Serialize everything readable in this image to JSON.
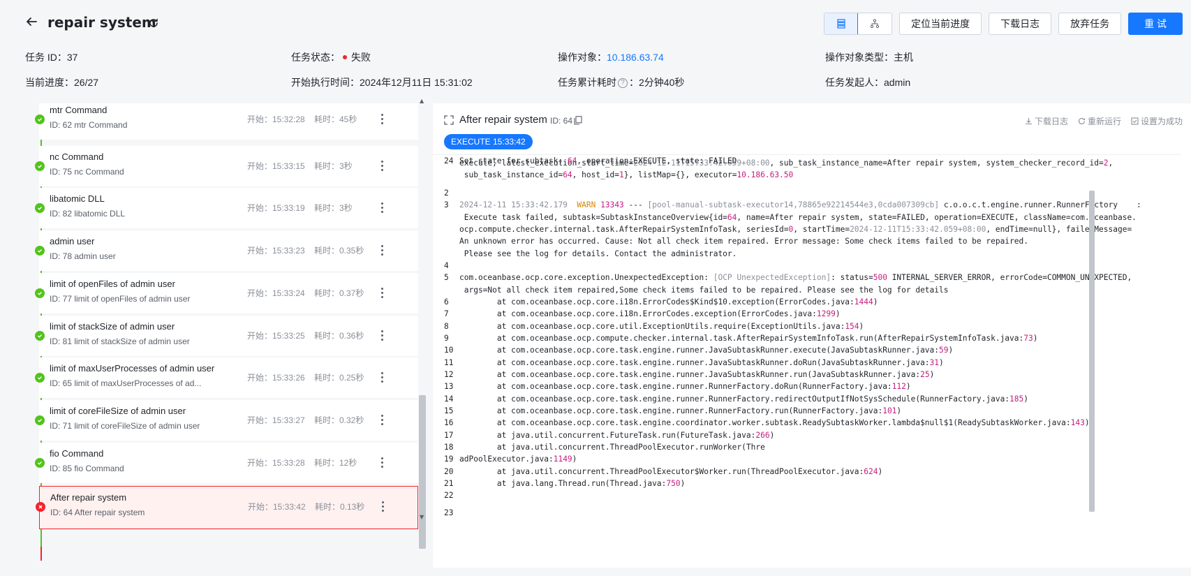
{
  "header": {
    "title": "repair system",
    "buttons": {
      "locate": "定位当前进度",
      "download_log": "下载日志",
      "abandon": "放弃任务",
      "retry": "重 试"
    }
  },
  "info": {
    "task_id_label": "任务 ID：",
    "task_id": "37",
    "status_label": "任务状态：",
    "status": "失败",
    "target_label": "操作对象：",
    "target": "10.186.63.74",
    "target_type_label": "操作对象类型：",
    "target_type": "主机",
    "progress_label": "当前进度：",
    "progress": "26/27",
    "start_label": "开始执行时间：",
    "start": "2024年12月11日 15:31:02",
    "elapsed_label": "任务累计耗时",
    "elapsed": "：2分钟40秒",
    "initiator_label": "任务发起人：",
    "initiator": "admin"
  },
  "tasks": [
    {
      "name": "mtr Command",
      "id": "ID: 62  mtr Command",
      "start": "开始：15:32:28",
      "dur": "耗时：45秒"
    },
    {
      "name": "nc Command",
      "id": "ID: 75  nc Command",
      "start": "开始：15:33:15",
      "dur": "耗时：3秒"
    },
    {
      "name": "libatomic DLL",
      "id": "ID: 82  libatomic DLL",
      "start": "开始：15:33:19",
      "dur": "耗时：3秒"
    },
    {
      "name": "admin user",
      "id": "ID: 78  admin user",
      "start": "开始：15:33:23",
      "dur": "耗时：0.35秒"
    },
    {
      "name": "limit of openFiles of admin user",
      "id": "ID: 77  limit of openFiles of admin user",
      "start": "开始：15:33:24",
      "dur": "耗时：0.37秒"
    },
    {
      "name": "limit of stackSize of admin user",
      "id": "ID: 81  limit of stackSize of admin user",
      "start": "开始：15:33:25",
      "dur": "耗时：0.36秒"
    },
    {
      "name": "limit of maxUserProcesses of admin user",
      "id": "ID: 65  limit of maxUserProcesses of ad...",
      "start": "开始：15:33:26",
      "dur": "耗时：0.25秒"
    },
    {
      "name": "limit of coreFileSize of admin user",
      "id": "ID: 71  limit of coreFileSize of admin user",
      "start": "开始：15:33:27",
      "dur": "耗时：0.32秒"
    },
    {
      "name": "fio Command",
      "id": "ID: 85  fio Command",
      "start": "开始：15:33:28",
      "dur": "耗时：12秒"
    },
    {
      "name": "After repair system",
      "id": "ID: 64  After repair system",
      "start": "开始：15:33:42",
      "dur": "耗时：0.13秒"
    }
  ],
  "detail": {
    "title": "After repair system",
    "id": "ID: 64",
    "actions": {
      "download": "下载日志",
      "rerun": "重新运行",
      "set_success": "设置为成功"
    },
    "tag": "EXECUTE 15:33:42"
  },
  "log": [
    {
      "n": "",
      "t": "execute, latest_execution_start_time=<span class=\"ts\">2024-12-11T15:33:42.059+08:00</span>, sub_task_instance_name=After repair system, system_checker_record_id=<span class=\"num\">2</span>,"
    },
    {
      "n": "",
      "t": " sub_task_instance_id=<span class=\"num\">64</span>, host_id=<span class=\"num\">1</span>}, listMap={}, executor=<span class=\"num\">10.186.63.50</span>"
    },
    {
      "n": "2",
      "t": ""
    },
    {
      "n": "3",
      "t": "<span class=\"ts\">2024-12-11 15:33:42.179</span>  <span class=\"warn\">WARN</span> <span class=\"num\">13343</span> --- <span class=\"thread\">[pool-manual-subtask-executor14,78865e92214544e3,0cda007309cb]</span> c.o.o.c.t.engine.runner.RunnerFactory    :"
    },
    {
      "n": "",
      "t": " Execute task failed, subtask=SubtaskInstanceOverview{id=<span class=\"num\">64</span>, name=After repair system, state=FAILED, operation=EXECUTE, className=com.oceanbase."
    },
    {
      "n": "",
      "t": "ocp.compute.checker.internal.task.AfterRepairSystemInfoTask, seriesId=<span class=\"num\">0</span>, startTime=<span class=\"ts\">2024-12-11T15:33:42.059+08:00</span>, endTime=null}, failedMessage="
    },
    {
      "n": "",
      "t": "An unknown error has occurred. Cause: Not all check item repaired. Error message: Some check items failed to be repaired."
    },
    {
      "n": "",
      "t": " Please see the log for details. Contact the administrator."
    },
    {
      "n": "4",
      "t": ""
    },
    {
      "n": "5",
      "t": "com.oceanbase.ocp.core.exception.UnexpectedException: <span class=\"thread\">[OCP UnexpectedException]</span>: status=<span class=\"num\">500</span> INTERNAL_SERVER_ERROR, errorCode=COMMON_UNEXPECTED,"
    },
    {
      "n": "",
      "t": " args=Not all check item repaired,Some check items failed to be repaired. Please see the log for details"
    },
    {
      "n": "6",
      "t": "        at com.oceanbase.ocp.core.i18n.ErrorCodes$Kind$10.exception(ErrorCodes.java:<span class=\"num\">1444</span>)"
    },
    {
      "n": "7",
      "t": "        at com.oceanbase.ocp.core.i18n.ErrorCodes.exception(ErrorCodes.java:<span class=\"num\">1299</span>)"
    },
    {
      "n": "8",
      "t": "        at com.oceanbase.ocp.core.util.ExceptionUtils.require(ExceptionUtils.java:<span class=\"num\">154</span>)"
    },
    {
      "n": "9",
      "t": "        at com.oceanbase.ocp.compute.checker.internal.task.AfterRepairSystemInfoTask.run(AfterRepairSystemInfoTask.java:<span class=\"num\">73</span>)"
    },
    {
      "n": "10",
      "t": "        at com.oceanbase.ocp.core.task.engine.runner.JavaSubtaskRunner.execute(JavaSubtaskRunner.java:<span class=\"num\">59</span>)"
    },
    {
      "n": "11",
      "t": "        at com.oceanbase.ocp.core.task.engine.runner.JavaSubtaskRunner.doRun(JavaSubtaskRunner.java:<span class=\"num\">31</span>)"
    },
    {
      "n": "12",
      "t": "        at com.oceanbase.ocp.core.task.engine.runner.JavaSubtaskRunner.run(JavaSubtaskRunner.java:<span class=\"num\">25</span>)"
    },
    {
      "n": "13",
      "t": "        at com.oceanbase.ocp.core.task.engine.runner.RunnerFactory.doRun(RunnerFactory.java:<span class=\"num\">112</span>)"
    },
    {
      "n": "14",
      "t": "        at com.oceanbase.ocp.core.task.engine.runner.RunnerFactory.redirectOutputIfNotSysSchedule(RunnerFactory.java:<span class=\"num\">185</span>)"
    },
    {
      "n": "15",
      "t": "        at com.oceanbase.ocp.core.task.engine.runner.RunnerFactory.run(RunnerFactory.java:<span class=\"num\">101</span>)"
    },
    {
      "n": "16",
      "t": "        at com.oceanbase.ocp.core.task.engine.coordinator.worker.subtask.ReadySubtaskWorker.lambda$null$1(ReadySubtaskWorker.java:<span class=\"num\">143</span>)"
    },
    {
      "n": "17",
      "t": "        at java.util.concurrent.FutureTask.run(FutureTask.java:<span class=\"num\">266</span>)"
    },
    {
      "n": "18",
      "t": "        at java.util.concurrent.ThreadPoolExecutor.runWorker(Thre"
    },
    {
      "n": "19",
      "t": "adPoolExecutor.java:<span class=\"num\">1149</span>)"
    },
    {
      "n": "20",
      "t": "        at java.util.concurrent.ThreadPoolExecutor$Worker.run(ThreadPoolExecutor.java:<span class=\"num\">624</span>)"
    },
    {
      "n": "21",
      "t": "        at java.lang.Thread.run(Thread.java:<span class=\"num\">750</span>)"
    },
    {
      "n": "22",
      "t": ""
    },
    {
      "n": "23",
      "t": ""
    },
    {
      "n": "24",
      "t": "Set state for subtask: <span class=\"num\">64</span>, operation:EXECUTE, state: FAILED"
    }
  ]
}
